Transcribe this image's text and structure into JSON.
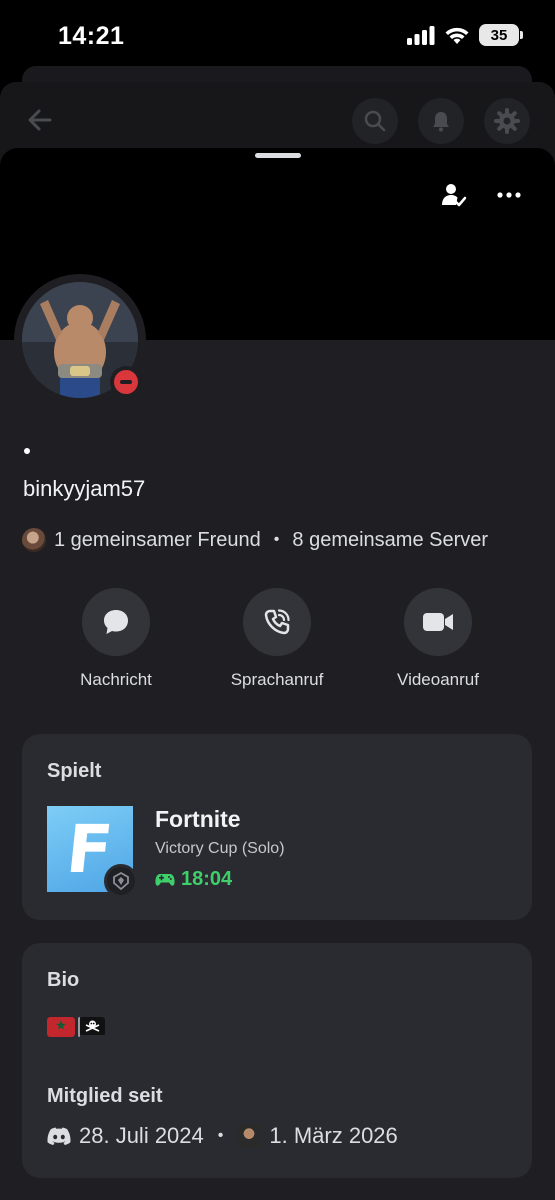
{
  "status_bar": {
    "time": "14:21",
    "battery": "35"
  },
  "profile": {
    "username": "binkyyjam57",
    "mutual_friends": "1 gemeinsamer Freund",
    "separator": "•",
    "mutual_servers": "8 gemeinsame Server",
    "status": "do-not-disturb"
  },
  "actions": [
    {
      "label": "Nachricht",
      "icon": "chat-bubble-icon"
    },
    {
      "label": "Sprachanruf",
      "icon": "phone-icon"
    },
    {
      "label": "Videoanruf",
      "icon": "video-camera-icon"
    }
  ],
  "activity": {
    "heading": "Spielt",
    "game": "Fortnite",
    "detail": "Victory Cup (Solo)",
    "elapsed": "18:04",
    "icon_letter": "F"
  },
  "bio": {
    "heading": "Bio",
    "flags": [
      "morocco-flag",
      "pirate-flag"
    ]
  },
  "member_since": {
    "heading": "Mitglied seit",
    "discord_date": "28. Juli 2024",
    "server_date": "1. März 2026"
  },
  "colors": {
    "accent_green": "#3ecf6a",
    "dnd_red": "#da373c",
    "card_bg": "#2a2b31",
    "sheet_bg": "#1f1f23"
  }
}
